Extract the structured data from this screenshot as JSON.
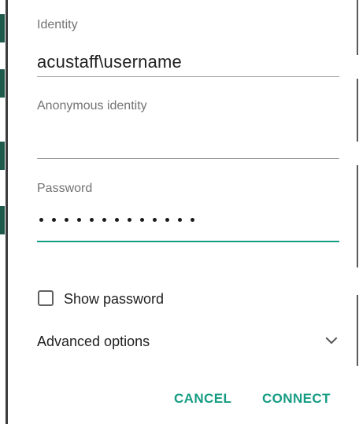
{
  "dialog": {
    "identity": {
      "label": "Identity",
      "value": "acustaff\\username"
    },
    "anonymous_identity": {
      "label": "Anonymous identity",
      "value": ""
    },
    "password": {
      "label": "Password",
      "masked_length": 13
    },
    "show_password": {
      "label": "Show password",
      "checked": false
    },
    "advanced_options": {
      "label": "Advanced options",
      "icon": "chevron-down-icon"
    },
    "actions": {
      "cancel_label": "CANCEL",
      "connect_label": "CONNECT"
    }
  },
  "colors": {
    "accent": "#169c83",
    "text_primary": "#212121",
    "text_secondary": "#737373",
    "divider": "#9e9e9e"
  }
}
